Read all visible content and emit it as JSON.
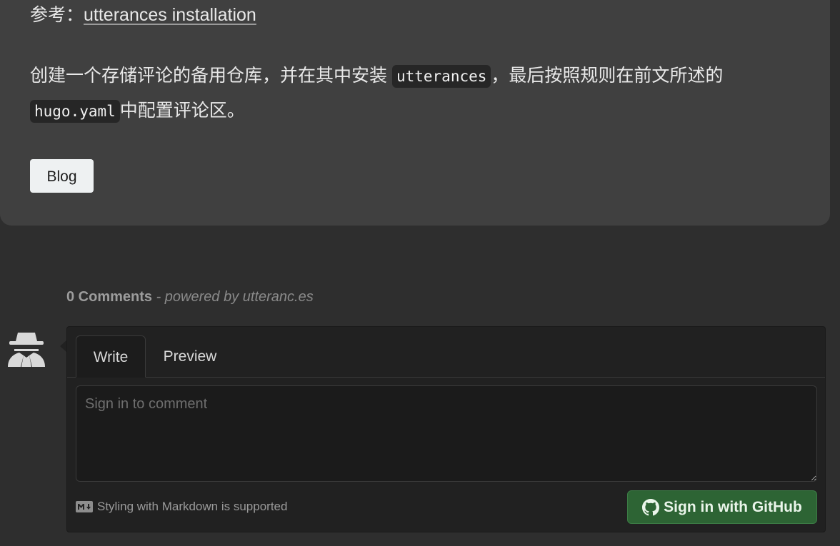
{
  "article": {
    "ref_prefix": "参考：",
    "ref_link": "utterances installation",
    "para_part1": "创建一个存储评论的备用仓库，并在其中安装",
    "para_code1": "utterances",
    "para_part2": "，最后按照规则在前文所述的",
    "para_code2": "hugo.yaml",
    "para_part3": "中配置评论区。",
    "tag_label": "Blog"
  },
  "comments": {
    "count_label": "0 Comments",
    "powered_label": "- powered by utteranc.es",
    "tabs": [
      {
        "label": "Write"
      },
      {
        "label": "Preview"
      }
    ],
    "textarea_placeholder": "Sign in to comment",
    "textarea_value": "",
    "markdown_hint": "Styling with Markdown is supported",
    "signin_label": "Sign in with GitHub"
  },
  "icons": {
    "avatar": "anonymous-user-icon",
    "markdown": "markdown-icon",
    "github": "github-icon"
  },
  "colors": {
    "page_bg": "#2e2e2e",
    "card_bg": "#404040",
    "signin_bg": "#2d6434",
    "tag_bg": "#eef1f2"
  }
}
